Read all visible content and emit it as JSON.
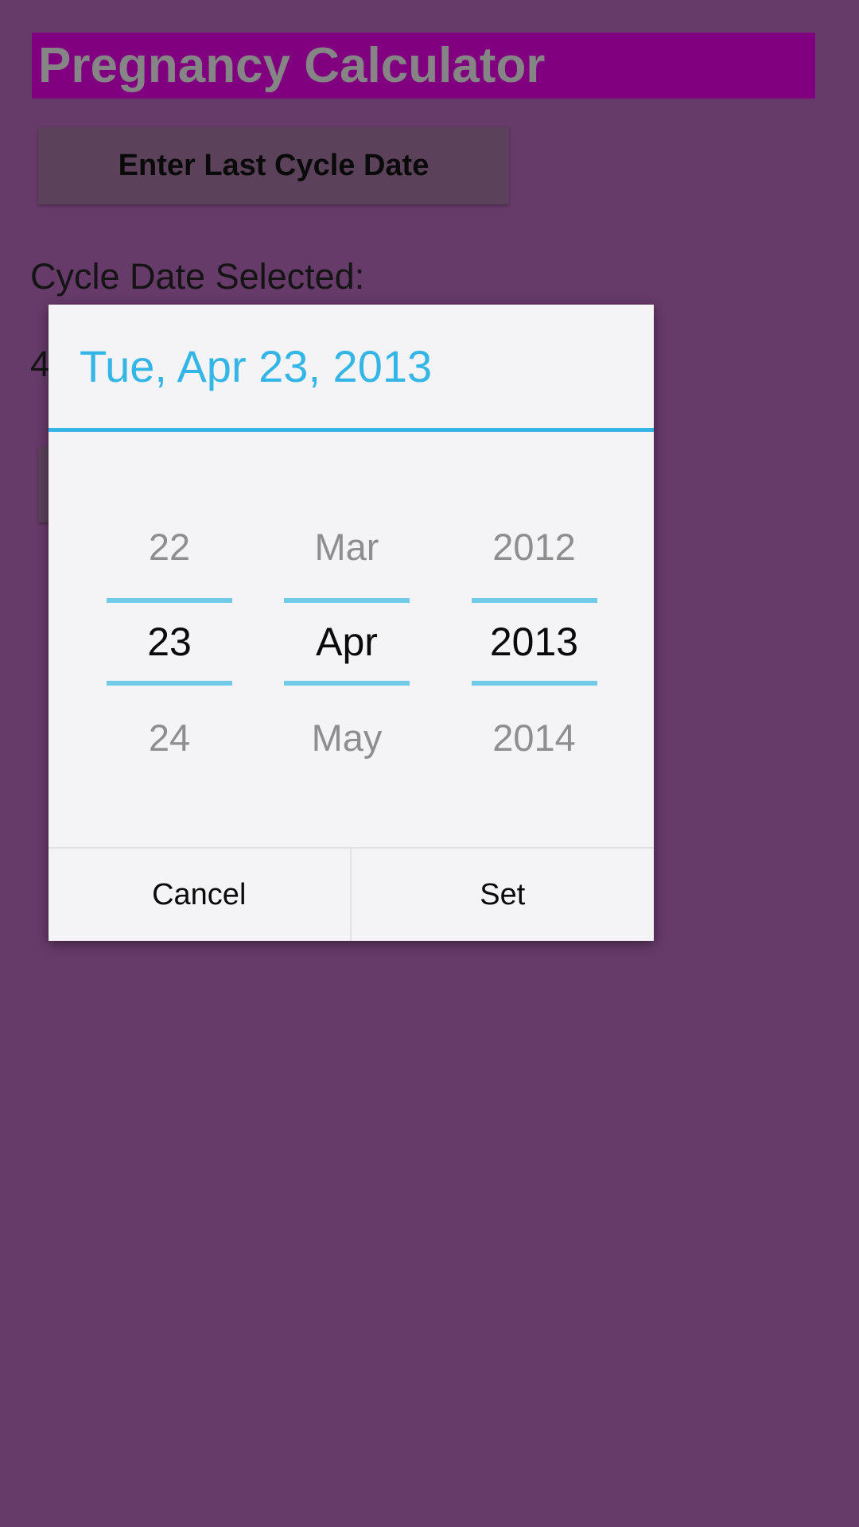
{
  "app": {
    "title": "Pregnancy Calculator",
    "enter_date_button": "Enter Last Cycle Date",
    "cycle_date_label": "Cycle Date Selected:",
    "cycle_date_value": "4",
    "colors": {
      "background": "#663a69",
      "title_bar": "#800080",
      "title_text": "#858585",
      "button": "#5b4159",
      "accent_blue": "#33b5e5"
    }
  },
  "dialog": {
    "header_date": "Tue, Apr 23, 2013",
    "spinners": [
      {
        "name": "day",
        "previous": "22",
        "current": "23",
        "next": "24"
      },
      {
        "name": "month",
        "previous": "Mar",
        "current": "Apr",
        "next": "May"
      },
      {
        "name": "year",
        "previous": "2012",
        "current": "2013",
        "next": "2014"
      }
    ],
    "buttons": {
      "cancel": "Cancel",
      "set": "Set"
    }
  }
}
